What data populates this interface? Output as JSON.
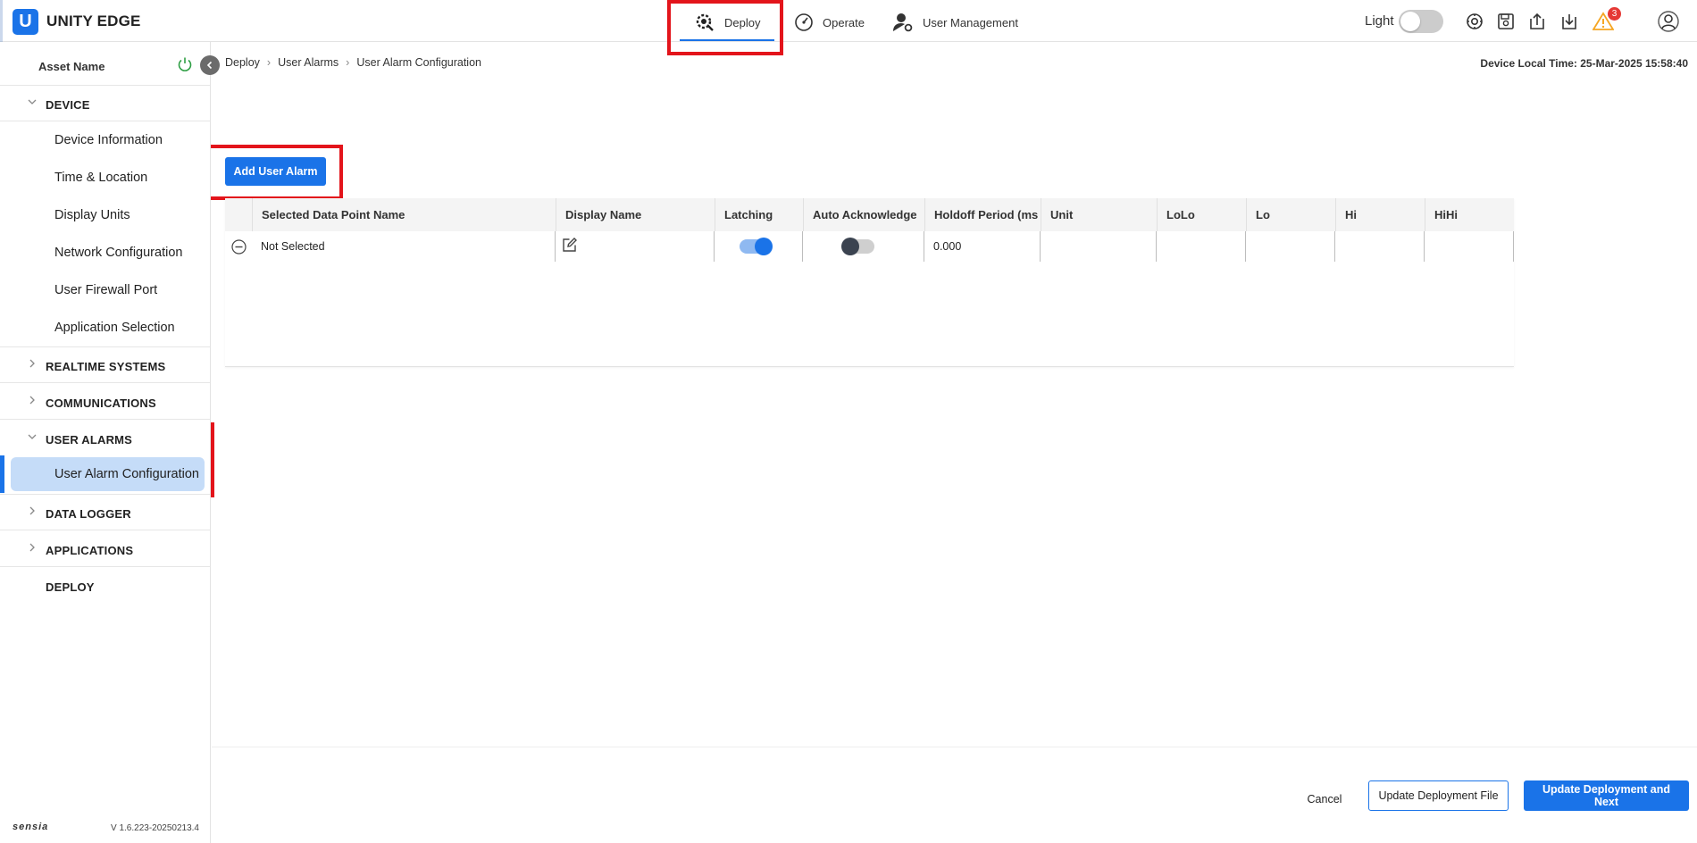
{
  "app": {
    "logo_letter": "U",
    "title": "UNITY EDGE"
  },
  "nav": {
    "tabs": [
      {
        "label": "Deploy",
        "icon": "deploy-gear-icon",
        "active": true
      },
      {
        "label": "Operate",
        "icon": "gauge-icon",
        "active": false
      },
      {
        "label": "User Management",
        "icon": "user-gear-icon",
        "active": false
      }
    ]
  },
  "toolbar": {
    "theme_label": "Light",
    "theme_dark_enabled": false,
    "alert_count": "3",
    "icons": [
      "settings-sync-icon",
      "save-disk-icon",
      "upload-icon",
      "download-icon",
      "warning-icon",
      "user-avatar-icon"
    ]
  },
  "sidebar": {
    "asset_name": "Asset Name",
    "sections": [
      {
        "label": "DEVICE",
        "expanded": true,
        "items": [
          "Device Information",
          "Time & Location",
          "Display Units",
          "Network Configuration",
          "User Firewall Port",
          "Application Selection"
        ]
      },
      {
        "label": "REALTIME SYSTEMS",
        "expanded": false
      },
      {
        "label": "COMMUNICATIONS",
        "expanded": false
      },
      {
        "label": "USER ALARMS",
        "expanded": true,
        "items": [
          "User Alarm Configuration"
        ],
        "selected": "User Alarm Configuration"
      },
      {
        "label": "DATA LOGGER",
        "expanded": false
      },
      {
        "label": "APPLICATIONS",
        "expanded": false
      },
      {
        "label": "DEPLOY",
        "expanded": false
      }
    ],
    "brand": "sensia",
    "version": "V 1.6.223-20250213.4"
  },
  "breadcrumb": [
    "Deploy",
    "User Alarms",
    "User Alarm Configuration"
  ],
  "device_time": "Device Local Time: 25-Mar-2025 15:58:40",
  "add_button": "Add User Alarm",
  "table": {
    "columns": [
      "Selected Data Point Name",
      "Display Name",
      "Latching",
      "Auto Acknowledge",
      "Holdoff Period (ms",
      "Unit",
      "LoLo",
      "Lo",
      "Hi",
      "HiHi"
    ],
    "rows": [
      {
        "data_point": "Not Selected",
        "display_name": "",
        "latching": true,
        "auto_acknowledge": false,
        "holdoff": "0.000",
        "unit": "",
        "lolo": "",
        "lo": "",
        "hi": "",
        "hihi": ""
      }
    ]
  },
  "footer": {
    "cancel": "Cancel",
    "update_file": "Update Deployment File",
    "update_next": "Update Deployment and Next"
  },
  "colors": {
    "accent": "#1a73e8",
    "highlight": "#e3141b",
    "selected_bg": "#c5dcf8",
    "warning": "#f5a623"
  }
}
